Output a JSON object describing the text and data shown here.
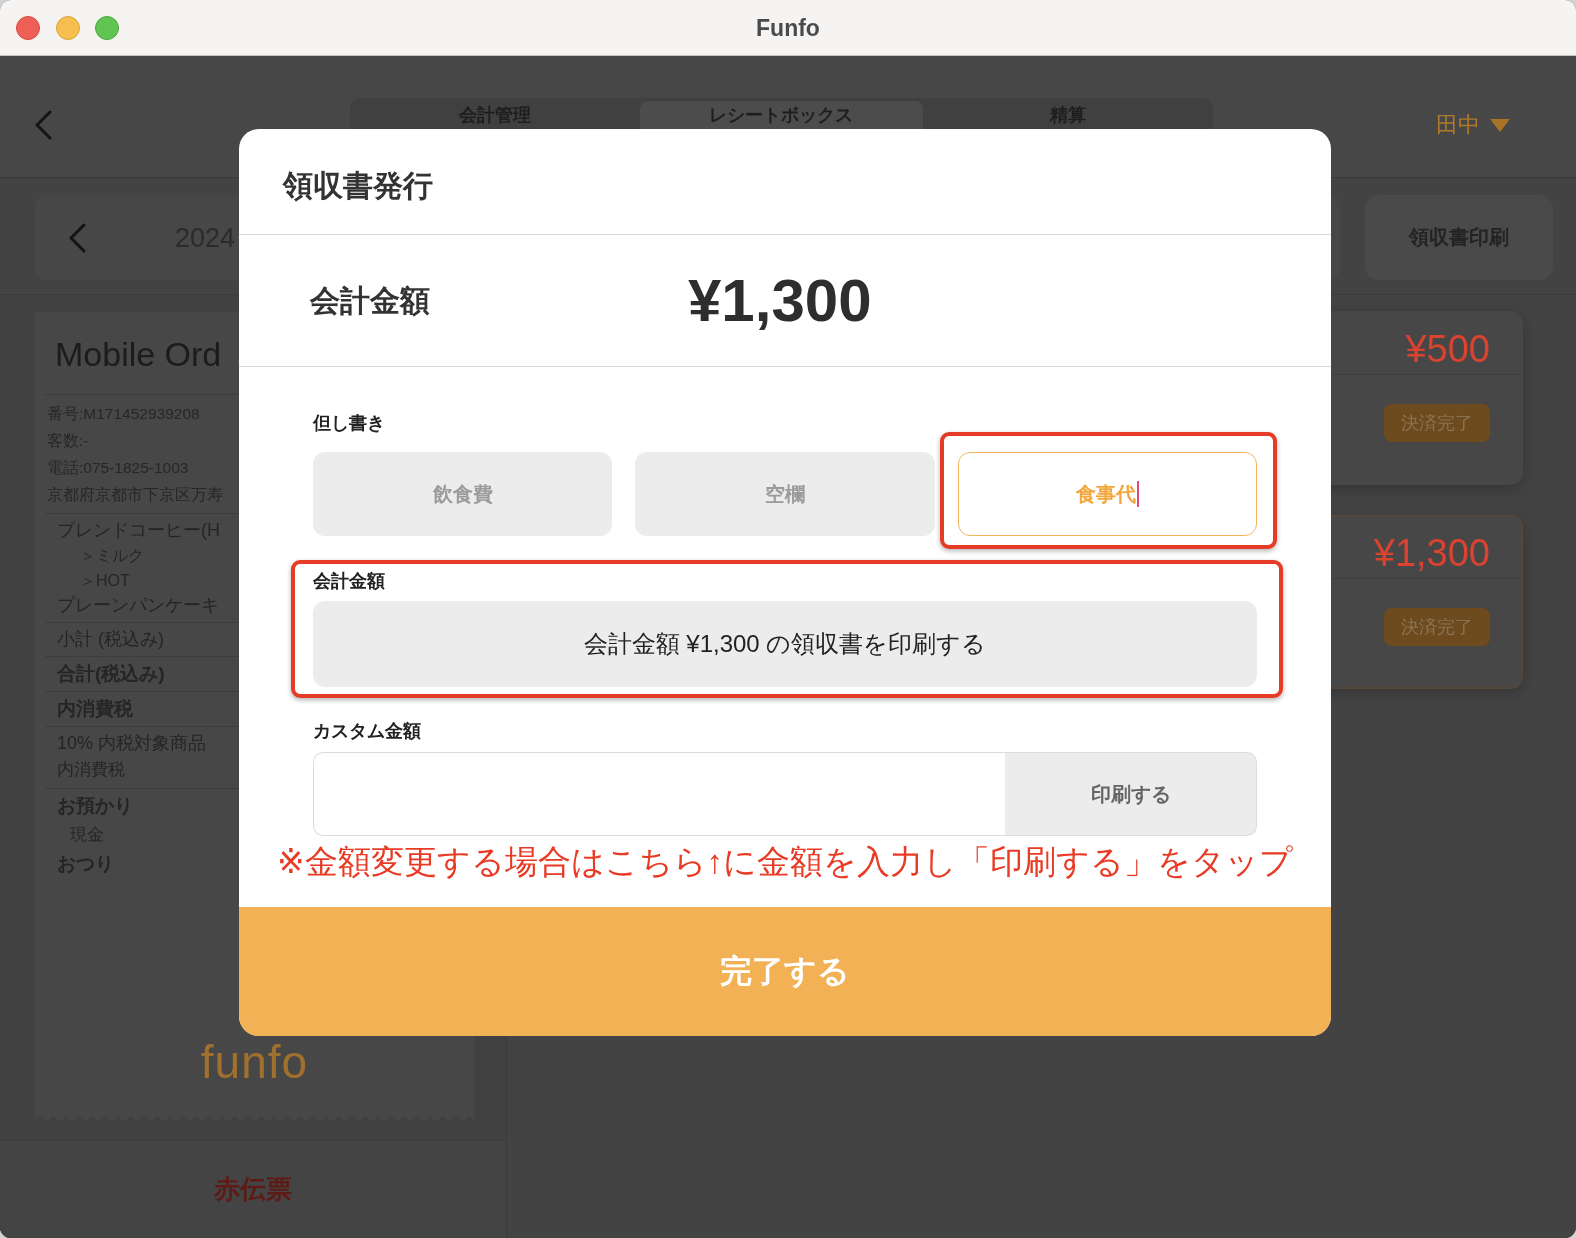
{
  "window": {
    "title": "Funfo"
  },
  "nav": {
    "tabs": [
      {
        "label": "会計管理",
        "selected": false
      },
      {
        "label": "レシートボックス",
        "selected": true
      },
      {
        "label": "精算",
        "selected": false
      }
    ],
    "user": "田中"
  },
  "toolbar": {
    "date": "2024",
    "receipt_print_button": "領収書印刷"
  },
  "receipt": {
    "title": "Mobile Ord",
    "info": [
      "番号:M171452939208",
      "客数:-",
      "電話:075-1825-1003",
      "京都府京都市下京区万寿"
    ],
    "sections": [
      [
        {
          "text": "ブレンドコーヒー(H",
          "kind": "item"
        },
        {
          "text": "＞ミルク",
          "kind": "option"
        },
        {
          "text": "＞HOT",
          "kind": "option"
        },
        {
          "text": "プレーンパンケーキ",
          "kind": "item"
        }
      ],
      [
        {
          "text": "小計 (税込み)",
          "kind": "label"
        }
      ],
      [
        {
          "text": "合計(税込み)",
          "kind": "strong"
        }
      ],
      [
        {
          "text": "内消費税",
          "kind": "strong"
        }
      ],
      [
        {
          "text": "10% 内税対象商品",
          "kind": "label"
        },
        {
          "text": "内消費税",
          "kind": "small"
        }
      ],
      [
        {
          "text": "お預かり",
          "kind": "strong"
        },
        {
          "text": "現金",
          "kind": "indent"
        },
        {
          "text": "おつり",
          "kind": "strong"
        }
      ]
    ],
    "logo": "funfo"
  },
  "red_slip_button": "赤伝票",
  "payments": [
    {
      "amount": "¥500",
      "status": "決済完了",
      "selected": false
    },
    {
      "amount": "¥1,300",
      "status": "決済完了",
      "selected": true
    }
  ],
  "dialog": {
    "title": "領収書発行",
    "total_label": "会計金額",
    "total": "¥1,300",
    "memo": {
      "label": "但し書き",
      "options": [
        {
          "label": "飲食費",
          "selected": false,
          "annotated": false
        },
        {
          "label": "空欄",
          "selected": false,
          "annotated": false
        },
        {
          "label": "食事代",
          "selected": true,
          "annotated": true
        }
      ]
    },
    "print_total": {
      "label": "会計金額",
      "button": "会計金額 ¥1,300 の領収書を印刷する",
      "annotated": true
    },
    "custom_amount": {
      "label": "カスタム金額",
      "button": "印刷する"
    },
    "note": "※金額変更する場合はこちら↑に金額を入力し「印刷する」をタップ",
    "done_button": "完了する"
  }
}
